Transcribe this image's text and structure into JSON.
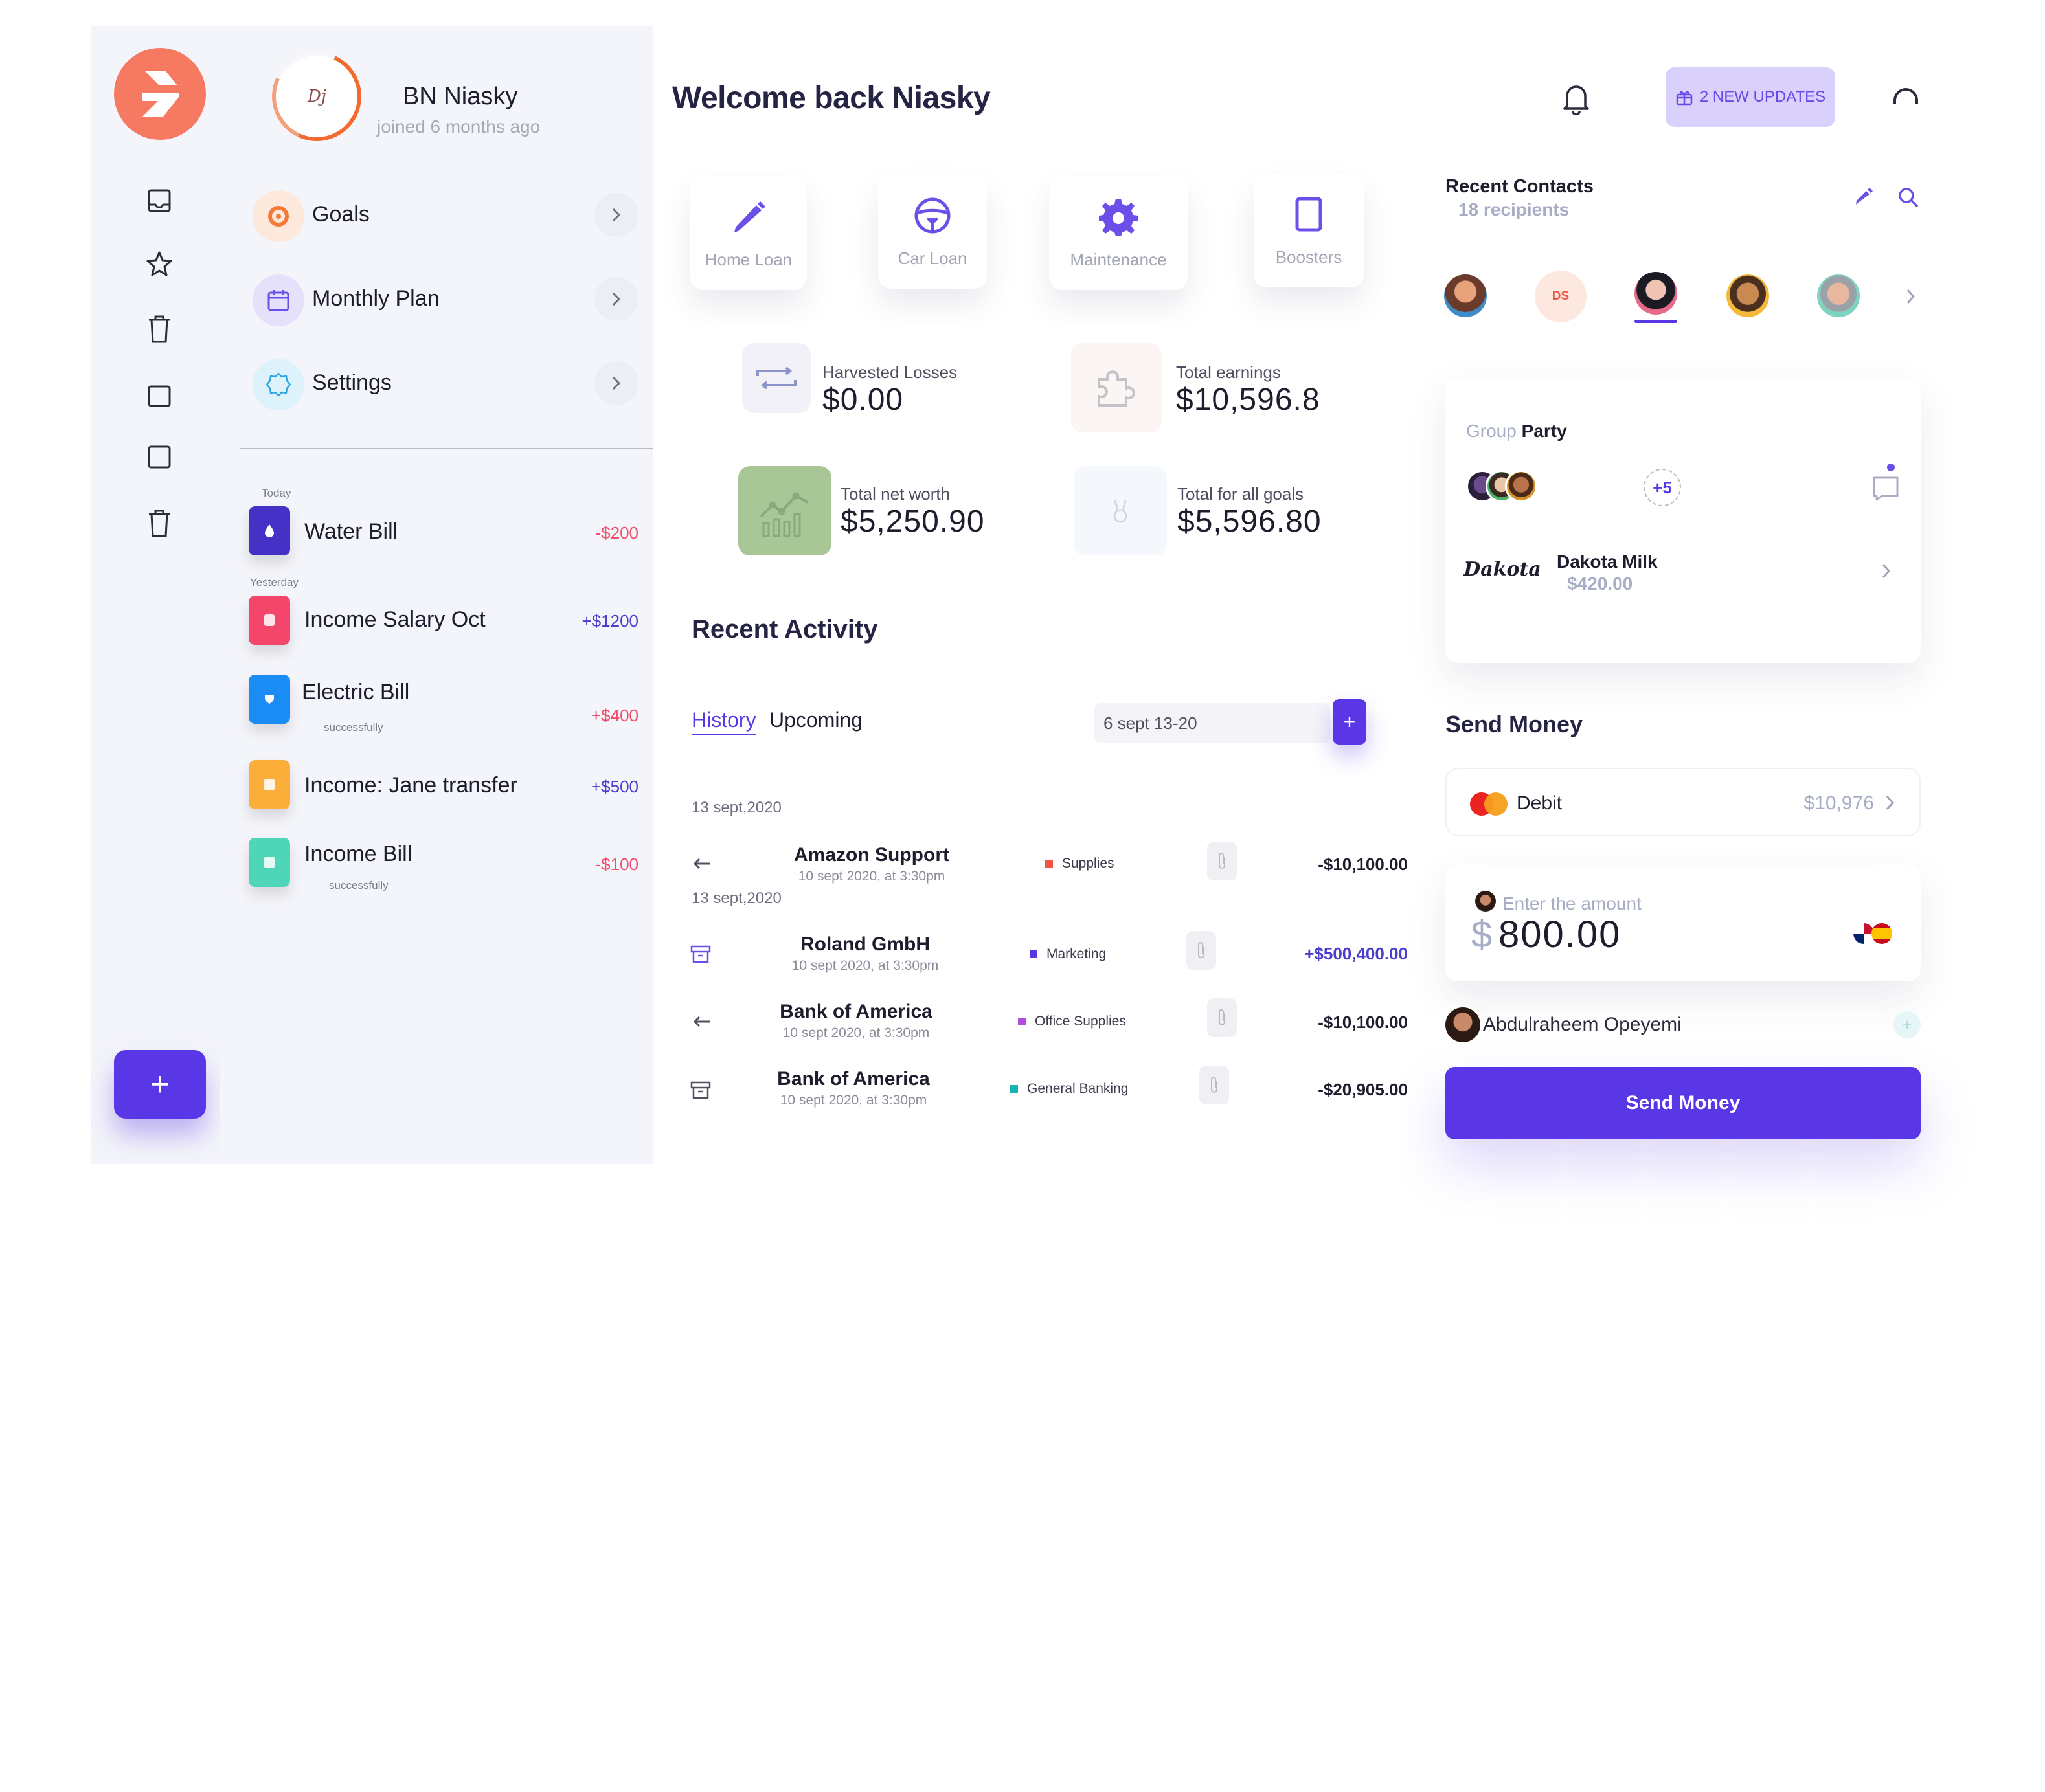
{
  "sidebar": {
    "icons": [
      "inbox-icon",
      "star-icon",
      "trash-icon",
      "square-icon",
      "square-icon",
      "trash-icon"
    ],
    "add_label": "+"
  },
  "profile": {
    "name": "BN Niasky",
    "joined": "joined 6 months ago",
    "avatar_text": "Dj",
    "menu": [
      {
        "label": "Goals",
        "icon": "goals-icon"
      },
      {
        "label": "Monthly Plan",
        "icon": "calendar-icon"
      },
      {
        "label": "Settings",
        "icon": "settings-icon"
      }
    ]
  },
  "transactions": {
    "today_label": "Today",
    "yesterday_label": "Yesterday",
    "items": [
      {
        "name": "Water Bill",
        "amount": "-$200",
        "sub": "",
        "color": "#4531c6"
      },
      {
        "name": "Income Salary Oct",
        "amount": "+$1200",
        "sub": "",
        "color": "#f3466a"
      },
      {
        "name": "Electric Bill",
        "amount": "+$400",
        "sub": "successfully",
        "color": "#1c8cf5"
      },
      {
        "name": "Income: Jane transfer",
        "amount": "+$500",
        "sub": "",
        "color": "#fcae3a"
      },
      {
        "name": "Income Bill",
        "amount": "-$100",
        "sub": "successfully",
        "color": "#4fd5b8"
      }
    ]
  },
  "header": {
    "welcome": "Welcome back Niasky",
    "updates": "2 NEW UPDATES"
  },
  "categories": [
    {
      "label": "Home Loan",
      "icon": "pencil-icon"
    },
    {
      "label": "Car Loan",
      "icon": "steering-wheel-icon"
    },
    {
      "label": "Maintenance",
      "icon": "gear-icon"
    },
    {
      "label": "Boosters",
      "icon": "card-icon"
    }
  ],
  "stats": [
    {
      "label": "Harvested Losses",
      "value": "$0.00"
    },
    {
      "label": "Total earnings",
      "value": "$10,596.8"
    },
    {
      "label": "Total net worth",
      "value": "$5,250.90"
    },
    {
      "label": "Total for all goals",
      "value": "$5,596.80"
    }
  ],
  "activity": {
    "title": "Recent Activity",
    "tabs": [
      "History",
      "Upcoming"
    ],
    "date_range": "6 sept 13-20",
    "add_label": "+",
    "dates": [
      "13 sept,2020",
      "13 sept,2020"
    ],
    "rows": [
      {
        "name": "Amazon Support",
        "time": "10 sept 2020, at 3:30pm",
        "tag": "Supplies",
        "tag_color": "#f05545",
        "amount": "-$10,100.00",
        "icon": "arrow-left-icon"
      },
      {
        "name": "Roland GmbH",
        "time": "10 sept 2020, at 3:30pm",
        "tag": "Marketing",
        "tag_color": "#5a37e6",
        "amount": "+$500,400.00",
        "icon": "archive-icon"
      },
      {
        "name": "Bank of America",
        "time": "10 sept 2020, at 3:30pm",
        "tag": "Office Supplies",
        "tag_color": "#b04ce0",
        "amount": "-$10,100.00",
        "icon": "arrow-left-icon"
      },
      {
        "name": "Bank of America",
        "time": "10 sept 2020, at 3:30pm",
        "tag": "General Banking",
        "tag_color": "#1ab3b3",
        "amount": "-$20,905.00",
        "icon": "archive-icon"
      }
    ]
  },
  "contacts": {
    "title": "Recent Contacts",
    "subtitle": "18 recipients",
    "initials": "DS"
  },
  "group": {
    "title_a": "Group",
    "title_b": "Party",
    "more": "+5",
    "item_name": "Dakota Milk",
    "item_amount": "$420.00",
    "logo_text": "Dakota"
  },
  "send": {
    "title": "Send Money",
    "card_label": "Debit",
    "card_amount": "$10,976",
    "amount_label": "Enter the amount",
    "currency": "$",
    "amount": "800.00",
    "recipient": "Abdulraheem Opeyemi",
    "button": "Send Money"
  },
  "colors": {
    "accent": "#5a37e6",
    "logo": "#f57a61",
    "negative": "#f24b6a",
    "positive": "#4a3ccf"
  }
}
